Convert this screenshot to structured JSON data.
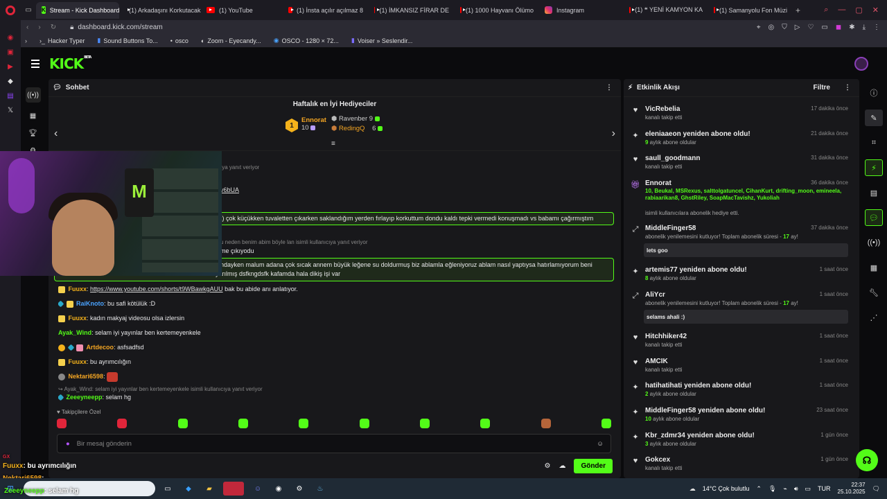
{
  "tabs": [
    {
      "label": "Stream - Kick Dashboard",
      "icon": "kick-icon",
      "active": true
    },
    {
      "label": "(1) Arkadaşını Korkutacak",
      "icon": "youtube-icon"
    },
    {
      "label": "(1) YouTube",
      "icon": "youtube-icon"
    },
    {
      "label": "(1) İnsta açılır açılmaz 8",
      "icon": "youtube-icon"
    },
    {
      "label": "(1) İMKANSIZ FİRAR DE",
      "icon": "youtube-icon"
    },
    {
      "label": "(1) 1000 Hayvanı Ölümo",
      "icon": "youtube-icon"
    },
    {
      "label": "Instagram",
      "icon": "instagram-icon"
    },
    {
      "label": "(1) ❝ YENİ KAMYON KA",
      "icon": "youtube-icon"
    },
    {
      "label": "(1) Samanyolu Fon Müzi",
      "icon": "youtube-icon"
    }
  ],
  "address": {
    "url": "dashboard.kick.com/stream"
  },
  "bookmarks": [
    "Hacker Typer",
    "Sound Buttons To...",
    "osco",
    "Zoom - Eyecandy...",
    "OSCO - 1280 × 72...",
    "Voiser » Seslendir..."
  ],
  "kick": {
    "logo": "KICK",
    "beta": "BETA"
  },
  "chat": {
    "title": "Sohbet",
    "gifters_title": "Haftalık en İyi Hediyeciler",
    "gifters": [
      {
        "rank": "1",
        "name": "Ennorat",
        "count": "10"
      },
      {
        "name": "Ravenber",
        "count": "9"
      },
      {
        "name": "RedingQ",
        "count": "6"
      }
    ],
    "messages": {
      "m1_reply": "ıya yanıt veriyor",
      "m1_link": "v6bUA",
      "m2_text": "ük) çok küçükken tuvaletten çıkarken saklandığım yerden fırlayıp korkuttum dondu kaldı tepki vermedi konuşmadı vs babamı çağırmıştım",
      "m3_reply": "u neden benim abim böyle lan isimli kullanıcıya yanıt veriyor",
      "m3_text": "me çıkıyodu",
      "m4_text1": "şındayken malum adana çok sıcak annem büyük leğene su doldurmuş biz ablamla eğleniyoruz ablam nasıl yaptıysa hatırlamıyorum beni",
      "m4_text2": "yarılmış dsfkngdsfk kafamda hala dikiş işi var",
      "m5_user": "Fuuxx",
      "m5_link": "https://www.youtube.com/shorts/t9WBawkgAUU",
      "m5_text": " bak bu abide anı anlatıyor.",
      "m6_user": "RaiKnoto",
      "m6_text": ": bu safi kötülük :D",
      "m7_user": "Fuuxx",
      "m7_text": ": kadın makyaj videosu olsa izlersin",
      "m8_user": "Ayak_Wind",
      "m8_text": ": selam iyi yayınlar ben kertemeyenkele",
      "m9_user": "Artdecoo",
      "m9_text": ": asfsadfsd",
      "m10_user": "Fuuxx",
      "m10_text": ": bu ayrımcılığın",
      "m11_user": "Nektari6598",
      "m11_text": ":",
      "m12_reply": "Ayak_Wind: selam iyi yayınlar ben kertemeyenkele isimli kullanıcıya yanıt veriyor",
      "m12_user": "Zeeeyneepp",
      "m12_text": ": selam hg"
    },
    "followers_label": "Takipçilere Özel",
    "input_placeholder": "Bir mesaj gönderin",
    "send_label": "Gönder"
  },
  "feed": {
    "title": "Etkinlik Akışı",
    "filter_label": "Filtre",
    "events": [
      {
        "name": "VicRebelia",
        "time": "17 dakika önce",
        "sub": "kanalı takip etti",
        "icon": "heart"
      },
      {
        "name": "eleniaaeon yeniden abone oldu!",
        "time": "21 dakika önce",
        "num": "9",
        "sub": " aylık abone oldular",
        "icon": "star"
      },
      {
        "name": "saull_goodmann",
        "time": "31 dakika önce",
        "sub": "kanalı takip etti",
        "icon": "heart"
      },
      {
        "name": "Ennorat",
        "time": "36 dakika önce",
        "gifted": "10, Beukal, MSRexus, salttolgatuncel, CihanKurt, drifting_moon, emineela, rabiaarikan8, GhstRiley, SoapMacTavishz, Yukoliah",
        "sub": "isimli kullanıcılara abonelik hediye etti.",
        "icon": "gift"
      },
      {
        "name": "MiddleFinger58",
        "time": "37 dakika önce",
        "sub": "abonelik yenilemesini kutluyor! Toplam abonelik süresi - ",
        "num2": "17",
        "sub2": " ay!",
        "quote": "lets goo",
        "icon": "resub"
      },
      {
        "name": "artemis77 yeniden abone oldu!",
        "time": "1 saat önce",
        "num": "8",
        "sub": " aylık abone oldular",
        "icon": "star"
      },
      {
        "name": "AliYcr",
        "time": "1 saat önce",
        "sub": "abonelik yenilemesini kutluyor! Toplam abonelik süresi - ",
        "num2": "17",
        "sub2": " ay!",
        "quote": "selams ahali :)",
        "icon": "resub"
      },
      {
        "name": "Hitchhiker42",
        "time": "1 saat önce",
        "sub": "kanalı takip etti",
        "icon": "heart"
      },
      {
        "name": "AMCIK",
        "time": "1 saat önce",
        "sub": "kanalı takip etti",
        "icon": "heart"
      },
      {
        "name": "hatihatihati yeniden abone oldu!",
        "time": "1 saat önce",
        "num": "2",
        "sub": " aylık abone oldular",
        "icon": "star"
      },
      {
        "name": "MiddleFinger58 yeniden abone oldu!",
        "time": "23 saat önce",
        "num": "10",
        "sub": " aylık abone oldular",
        "icon": "star"
      },
      {
        "name": "Kbr_zdmr34 yeniden abone oldu!",
        "time": "1 gün önce",
        "num": "3",
        "sub": " aylık abone oldular",
        "icon": "star"
      },
      {
        "name": "Gokcex",
        "time": "1 gün önce",
        "sub": "kanalı takip etti",
        "icon": "heart"
      }
    ]
  },
  "overlay": {
    "line1_user": "Fuuxx",
    "line1_text": ": bu ayrımcılığın",
    "line2_user": "Nektari6598",
    "line2_text": ":",
    "line3_user": "Zeeeyneepp",
    "line3_text": ": selam hg",
    "gx_label": "GX"
  },
  "taskbar": {
    "weather": "14°C  Çok bulutlu",
    "lang": "TUR",
    "time": "22:37",
    "date": "25.10.2025"
  },
  "colors": {
    "kick_green": "#53fc18",
    "opera_red": "#e0253a",
    "panel_bg": "#18181b"
  }
}
